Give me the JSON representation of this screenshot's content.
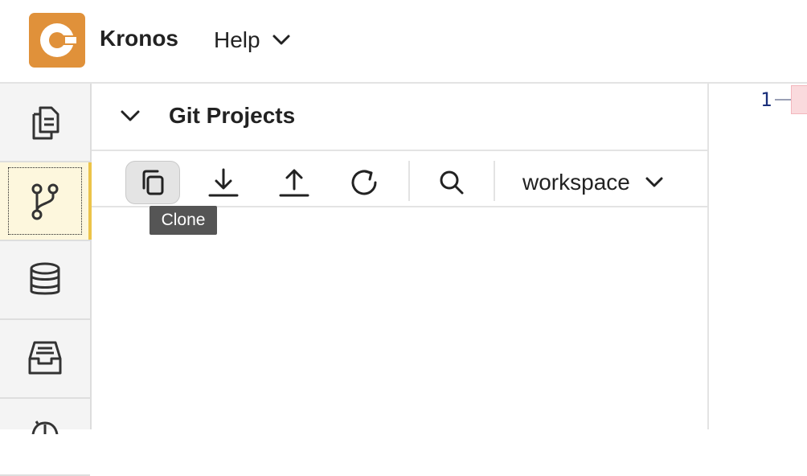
{
  "app": {
    "name": "Kronos"
  },
  "menu": {
    "help_label": "Help"
  },
  "activity_bar": {
    "items": [
      {
        "icon": "documents-icon",
        "active": false
      },
      {
        "icon": "git-branch-icon",
        "active": true
      },
      {
        "icon": "database-icon",
        "active": false
      },
      {
        "icon": "inbox-icon",
        "active": false
      },
      {
        "icon": "history-icon",
        "active": false
      }
    ]
  },
  "panel": {
    "title": "Git Projects",
    "toolbar": {
      "buttons": [
        {
          "icon": "clone-icon",
          "tooltip": "Clone"
        },
        {
          "icon": "download-icon"
        },
        {
          "icon": "upload-icon"
        },
        {
          "icon": "refresh-icon"
        },
        {
          "icon": "search-icon"
        }
      ],
      "workspace": "workspace"
    },
    "tooltip": "Clone"
  },
  "editor": {
    "line_number": "1"
  },
  "colors": {
    "brand": "#e0913a",
    "active_accent": "#ecc44a",
    "active_bg": "#fdf7dd"
  }
}
